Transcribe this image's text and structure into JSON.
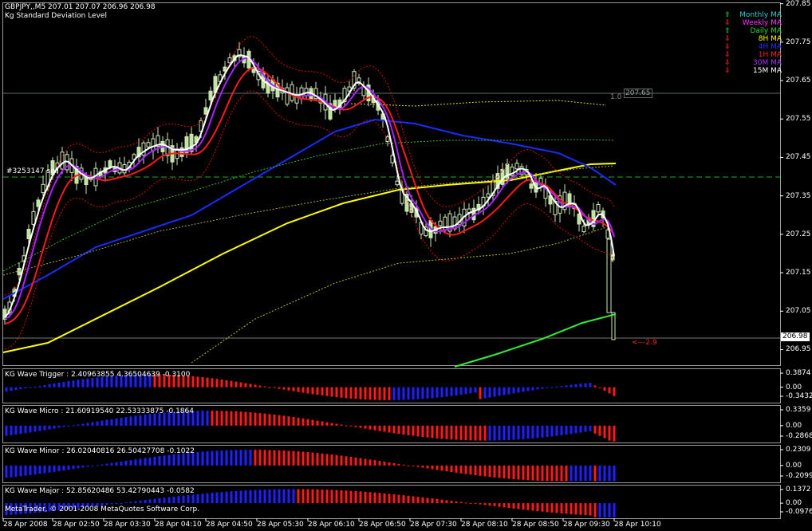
{
  "header": {
    "symbol_line": "GBPJPY,,M5  207.01 207.07 206.96 206.98",
    "indicator_name": "Kg Standard Deviation Level"
  },
  "legend": [
    {
      "arrow": "⇧",
      "label": "Monthly MA",
      "color": "#33cccc",
      "arrow_color": "#22cc22"
    },
    {
      "arrow": "⇩",
      "label": "Weekly MA",
      "color": "#ff33ff",
      "arrow_color": "#ff2222"
    },
    {
      "arrow": "⇧",
      "label": "Daily MA",
      "color": "#22dd22",
      "arrow_color": "#22cc22"
    },
    {
      "arrow": "⇩",
      "label": "8H MA",
      "color": "#ffff00",
      "arrow_color": "#ff2222"
    },
    {
      "arrow": "⇩",
      "label": "4H MA",
      "color": "#2233ff",
      "arrow_color": "#ff2222"
    },
    {
      "arrow": "⇩",
      "label": "1H MA",
      "color": "#ff2222",
      "arrow_color": "#ff2222"
    },
    {
      "arrow": "⇩",
      "label": "30M MA",
      "color": "#aa33ff",
      "arrow_color": "#ff2222"
    },
    {
      "arrow": "⇩",
      "label": "15M MA",
      "color": "#ffffff",
      "arrow_color": "#ff2222"
    }
  ],
  "main_chart": {
    "order_label": "#3253147 sell",
    "level_label": "1.0",
    "level_price": "207.65",
    "current_price": "206.98",
    "distance_label": "<---2.9",
    "price_ticks": [
      "207.85",
      "207.75",
      "207.65",
      "207.55",
      "207.45",
      "207.35",
      "207.25",
      "207.15",
      "207.05",
      "206.95"
    ]
  },
  "subwindows": [
    {
      "title": "KG Wave Trigger : 2.40963855 4.36504639 -0.3100",
      "ticks": [
        "0.3874",
        "0.00",
        "-0.3432"
      ]
    },
    {
      "title": "KG Wave Micro : 21.60919540 22.53333875 -0.1864",
      "ticks": [
        "0.3359",
        "0.00",
        "-0.2868"
      ]
    },
    {
      "title": "KG Wave Minor : 26.02040816 26.50427708 -0.1022",
      "ticks": [
        "0.2309",
        "0.00",
        "-0.2099"
      ]
    },
    {
      "title": "KG Wave Major : 52.85620486 53.42790443 -0.0582",
      "ticks": [
        "0.1372",
        "0.00",
        "-0.0976"
      ]
    }
  ],
  "copyright": "MetaTrader, © 2001-2008 MetaQuotes Software Corp.",
  "time_labels": [
    "28 Apr 2008",
    "28 Apr 02:50",
    "28 Apr 03:30",
    "28 Apr 04:10",
    "28 Apr 04:50",
    "28 Apr 05:30",
    "28 Apr 06:10",
    "28 Apr 06:50",
    "28 Apr 07:30",
    "28 Apr 08:10",
    "28 Apr 08:50",
    "28 Apr 09:30",
    "28 Apr 10:10"
  ],
  "colors": {
    "bull_candle": "#bfe6a0",
    "histogram_up": "#2020ff",
    "histogram_down": "#ff1a1a",
    "grid": "#7a7a7a"
  }
}
